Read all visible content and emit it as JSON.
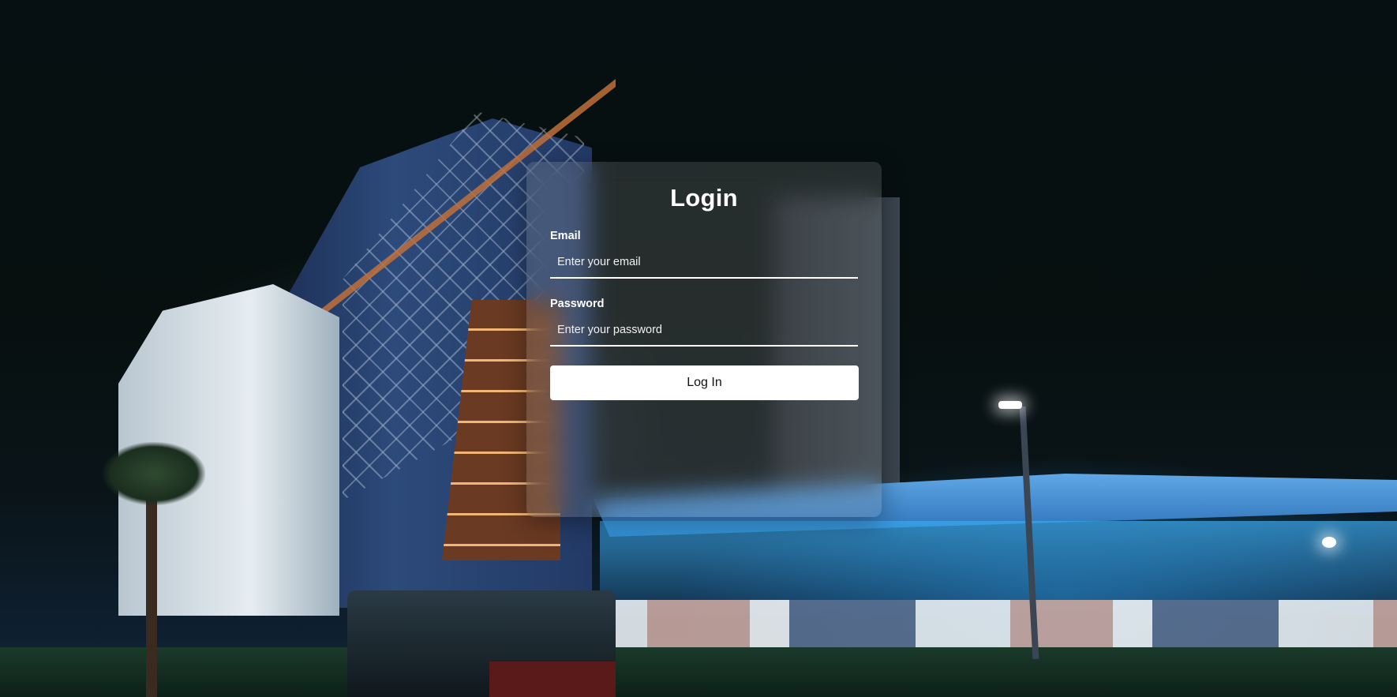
{
  "login": {
    "title": "Login",
    "email": {
      "label": "Email",
      "placeholder": "Enter your email",
      "value": ""
    },
    "password": {
      "label": "Password",
      "placeholder": "Enter your password",
      "value": ""
    },
    "submit_label": "Log In"
  },
  "colors": {
    "button_bg": "#ffffff",
    "button_text": "#111111",
    "text": "#ffffff",
    "card_bg": "rgba(150,150,150,0.22)"
  }
}
